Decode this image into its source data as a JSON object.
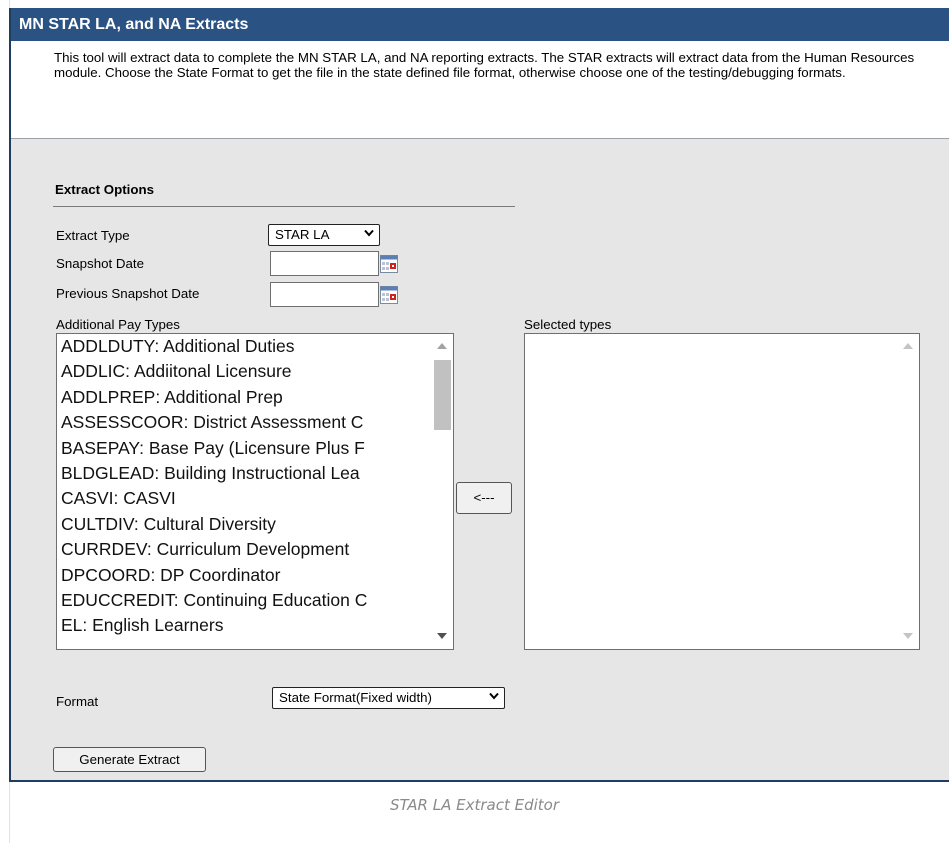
{
  "window": {
    "title": "MN STAR LA, and NA Extracts",
    "description": "This tool will extract data to complete the MN STAR LA, and NA reporting extracts. The STAR extracts will extract data from the Human Resources module. Choose the State Format to get the file in the state defined file format, otherwise choose one of the testing/debugging formats."
  },
  "extract_options": {
    "section_title": "Extract Options",
    "extract_type": {
      "label": "Extract Type",
      "value": "STAR LA"
    },
    "snapshot_date": {
      "label": "Snapshot Date",
      "value": ""
    },
    "previous_snapshot_date": {
      "label": "Previous Snapshot Date",
      "value": ""
    },
    "additional_pay_types": {
      "label": "Additional Pay Types",
      "items": [
        "ADDLDUTY: Additional Duties",
        "ADDLIC: Addiitonal Licensure",
        "ADDLPREP: Additional Prep",
        "ASSESSCOOR: District Assessment C",
        "BASEPAY: Base Pay (Licensure Plus F",
        "BLDGLEAD: Building Instructional Lea",
        "CASVI: CASVI",
        "CULTDIV: Cultural Diversity",
        "CURRDEV: Curriculum Development",
        "DPCOORD: DP Coordinator",
        "EDUCCREDIT: Continuing Education C",
        "EL: English Learners"
      ]
    },
    "move_button": "<---",
    "selected_types": {
      "label": "Selected types",
      "items": []
    },
    "format": {
      "label": "Format",
      "value": "State Format(Fixed width)"
    },
    "generate_button": "Generate Extract"
  },
  "caption": "STAR LA Extract Editor",
  "colors": {
    "title_bar": "#2a5384",
    "panel_bg": "#e6e6e6",
    "window_border": "#1f3d60"
  }
}
